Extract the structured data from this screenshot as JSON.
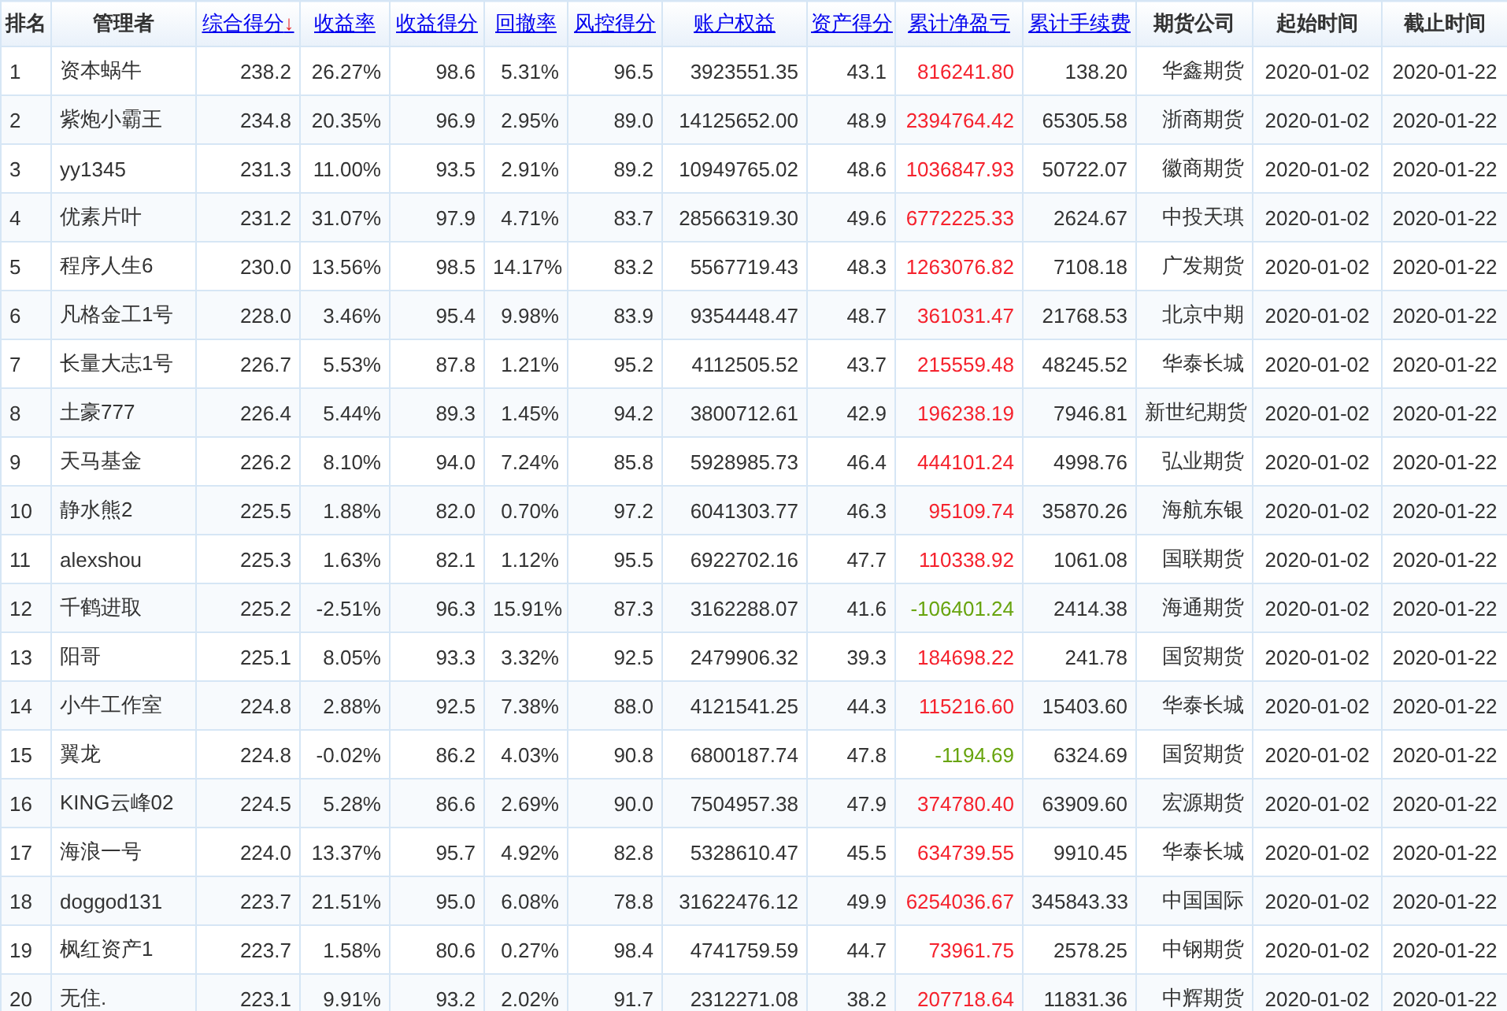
{
  "table": {
    "columns": [
      {
        "label": "排名",
        "link": false
      },
      {
        "label": "管理者",
        "link": false
      },
      {
        "label": "综合得分",
        "link": true,
        "sort_arrow": "↓"
      },
      {
        "label": "收益率",
        "link": true
      },
      {
        "label": "收益得分",
        "link": true
      },
      {
        "label": "回撤率",
        "link": true
      },
      {
        "label": "风控得分",
        "link": true
      },
      {
        "label": "账户权益",
        "link": true
      },
      {
        "label": "资产得分",
        "link": true
      },
      {
        "label": "累计净盈亏",
        "link": true
      },
      {
        "label": "累计手续费",
        "link": true
      },
      {
        "label": "期货公司",
        "link": false
      },
      {
        "label": "起始时间",
        "link": false
      },
      {
        "label": "截止时间",
        "link": false
      }
    ],
    "rows": [
      {
        "rank": "1",
        "manager": "资本蜗牛",
        "score": "238.2",
        "return_rate": "26.27%",
        "return_score": "98.6",
        "drawdown": "5.31%",
        "risk_score": "96.5",
        "equity": "3923551.35",
        "asset_score": "43.1",
        "net_pnl": "816241.80",
        "pnl_positive": true,
        "fees": "138.20",
        "broker": "华鑫期货",
        "start": "2020-01-02",
        "end": "2020-01-22"
      },
      {
        "rank": "2",
        "manager": "紫炮小霸王",
        "score": "234.8",
        "return_rate": "20.35%",
        "return_score": "96.9",
        "drawdown": "2.95%",
        "risk_score": "89.0",
        "equity": "14125652.00",
        "asset_score": "48.9",
        "net_pnl": "2394764.42",
        "pnl_positive": true,
        "fees": "65305.58",
        "broker": "浙商期货",
        "start": "2020-01-02",
        "end": "2020-01-22"
      },
      {
        "rank": "3",
        "manager": "yy1345",
        "score": "231.3",
        "return_rate": "11.00%",
        "return_score": "93.5",
        "drawdown": "2.91%",
        "risk_score": "89.2",
        "equity": "10949765.02",
        "asset_score": "48.6",
        "net_pnl": "1036847.93",
        "pnl_positive": true,
        "fees": "50722.07",
        "broker": "徽商期货",
        "start": "2020-01-02",
        "end": "2020-01-22"
      },
      {
        "rank": "4",
        "manager": "优素片叶",
        "score": "231.2",
        "return_rate": "31.07%",
        "return_score": "97.9",
        "drawdown": "4.71%",
        "risk_score": "83.7",
        "equity": "28566319.30",
        "asset_score": "49.6",
        "net_pnl": "6772225.33",
        "pnl_positive": true,
        "fees": "2624.67",
        "broker": "中投天琪",
        "start": "2020-01-02",
        "end": "2020-01-22"
      },
      {
        "rank": "5",
        "manager": "程序人生6",
        "score": "230.0",
        "return_rate": "13.56%",
        "return_score": "98.5",
        "drawdown": "14.17%",
        "risk_score": "83.2",
        "equity": "5567719.43",
        "asset_score": "48.3",
        "net_pnl": "1263076.82",
        "pnl_positive": true,
        "fees": "7108.18",
        "broker": "广发期货",
        "start": "2020-01-02",
        "end": "2020-01-22"
      },
      {
        "rank": "6",
        "manager": "凡格金工1号",
        "score": "228.0",
        "return_rate": "3.46%",
        "return_score": "95.4",
        "drawdown": "9.98%",
        "risk_score": "83.9",
        "equity": "9354448.47",
        "asset_score": "48.7",
        "net_pnl": "361031.47",
        "pnl_positive": true,
        "fees": "21768.53",
        "broker": "北京中期",
        "start": "2020-01-02",
        "end": "2020-01-22"
      },
      {
        "rank": "7",
        "manager": "长量大志1号",
        "score": "226.7",
        "return_rate": "5.53%",
        "return_score": "87.8",
        "drawdown": "1.21%",
        "risk_score": "95.2",
        "equity": "4112505.52",
        "asset_score": "43.7",
        "net_pnl": "215559.48",
        "pnl_positive": true,
        "fees": "48245.52",
        "broker": "华泰长城",
        "start": "2020-01-02",
        "end": "2020-01-22"
      },
      {
        "rank": "8",
        "manager": "土豪777",
        "score": "226.4",
        "return_rate": "5.44%",
        "return_score": "89.3",
        "drawdown": "1.45%",
        "risk_score": "94.2",
        "equity": "3800712.61",
        "asset_score": "42.9",
        "net_pnl": "196238.19",
        "pnl_positive": true,
        "fees": "7946.81",
        "broker": "新世纪期货",
        "start": "2020-01-02",
        "end": "2020-01-22"
      },
      {
        "rank": "9",
        "manager": "天马基金",
        "score": "226.2",
        "return_rate": "8.10%",
        "return_score": "94.0",
        "drawdown": "7.24%",
        "risk_score": "85.8",
        "equity": "5928985.73",
        "asset_score": "46.4",
        "net_pnl": "444101.24",
        "pnl_positive": true,
        "fees": "4998.76",
        "broker": "弘业期货",
        "start": "2020-01-02",
        "end": "2020-01-22"
      },
      {
        "rank": "10",
        "manager": "静水熊2",
        "score": "225.5",
        "return_rate": "1.88%",
        "return_score": "82.0",
        "drawdown": "0.70%",
        "risk_score": "97.2",
        "equity": "6041303.77",
        "asset_score": "46.3",
        "net_pnl": "95109.74",
        "pnl_positive": true,
        "fees": "35870.26",
        "broker": "海航东银",
        "start": "2020-01-02",
        "end": "2020-01-22"
      },
      {
        "rank": "11",
        "manager": "alexshou",
        "score": "225.3",
        "return_rate": "1.63%",
        "return_score": "82.1",
        "drawdown": "1.12%",
        "risk_score": "95.5",
        "equity": "6922702.16",
        "asset_score": "47.7",
        "net_pnl": "110338.92",
        "pnl_positive": true,
        "fees": "1061.08",
        "broker": "国联期货",
        "start": "2020-01-02",
        "end": "2020-01-22"
      },
      {
        "rank": "12",
        "manager": "千鹤进取",
        "score": "225.2",
        "return_rate": "-2.51%",
        "return_score": "96.3",
        "drawdown": "15.91%",
        "risk_score": "87.3",
        "equity": "3162288.07",
        "asset_score": "41.6",
        "net_pnl": "-106401.24",
        "pnl_positive": false,
        "fees": "2414.38",
        "broker": "海通期货",
        "start": "2020-01-02",
        "end": "2020-01-22"
      },
      {
        "rank": "13",
        "manager": "阳哥",
        "score": "225.1",
        "return_rate": "8.05%",
        "return_score": "93.3",
        "drawdown": "3.32%",
        "risk_score": "92.5",
        "equity": "2479906.32",
        "asset_score": "39.3",
        "net_pnl": "184698.22",
        "pnl_positive": true,
        "fees": "241.78",
        "broker": "国贸期货",
        "start": "2020-01-02",
        "end": "2020-01-22"
      },
      {
        "rank": "14",
        "manager": "小牛工作室",
        "score": "224.8",
        "return_rate": "2.88%",
        "return_score": "92.5",
        "drawdown": "7.38%",
        "risk_score": "88.0",
        "equity": "4121541.25",
        "asset_score": "44.3",
        "net_pnl": "115216.60",
        "pnl_positive": true,
        "fees": "15403.60",
        "broker": "华泰长城",
        "start": "2020-01-02",
        "end": "2020-01-22"
      },
      {
        "rank": "15",
        "manager": "翼龙",
        "score": "224.8",
        "return_rate": "-0.02%",
        "return_score": "86.2",
        "drawdown": "4.03%",
        "risk_score": "90.8",
        "equity": "6800187.74",
        "asset_score": "47.8",
        "net_pnl": "-1194.69",
        "pnl_positive": false,
        "fees": "6324.69",
        "broker": "国贸期货",
        "start": "2020-01-02",
        "end": "2020-01-22"
      },
      {
        "rank": "16",
        "manager": "KING云峰02",
        "score": "224.5",
        "return_rate": "5.28%",
        "return_score": "86.6",
        "drawdown": "2.69%",
        "risk_score": "90.0",
        "equity": "7504957.38",
        "asset_score": "47.9",
        "net_pnl": "374780.40",
        "pnl_positive": true,
        "fees": "63909.60",
        "broker": "宏源期货",
        "start": "2020-01-02",
        "end": "2020-01-22"
      },
      {
        "rank": "17",
        "manager": "海浪一号",
        "score": "224.0",
        "return_rate": "13.37%",
        "return_score": "95.7",
        "drawdown": "4.92%",
        "risk_score": "82.8",
        "equity": "5328610.47",
        "asset_score": "45.5",
        "net_pnl": "634739.55",
        "pnl_positive": true,
        "fees": "9910.45",
        "broker": "华泰长城",
        "start": "2020-01-02",
        "end": "2020-01-22"
      },
      {
        "rank": "18",
        "manager": "doggod131",
        "score": "223.7",
        "return_rate": "21.51%",
        "return_score": "95.0",
        "drawdown": "6.08%",
        "risk_score": "78.8",
        "equity": "31622476.12",
        "asset_score": "49.9",
        "net_pnl": "6254036.67",
        "pnl_positive": true,
        "fees": "345843.33",
        "broker": "中国国际",
        "start": "2020-01-02",
        "end": "2020-01-22"
      },
      {
        "rank": "19",
        "manager": "枫红资产1",
        "score": "223.7",
        "return_rate": "1.58%",
        "return_score": "80.6",
        "drawdown": "0.27%",
        "risk_score": "98.4",
        "equity": "4741759.59",
        "asset_score": "44.7",
        "net_pnl": "73961.75",
        "pnl_positive": true,
        "fees": "2578.25",
        "broker": "中钢期货",
        "start": "2020-01-02",
        "end": "2020-01-22"
      },
      {
        "rank": "20",
        "manager": "无住.",
        "score": "223.1",
        "return_rate": "9.91%",
        "return_score": "93.2",
        "drawdown": "2.02%",
        "risk_score": "91.7",
        "equity": "2312271.08",
        "asset_score": "38.2",
        "net_pnl": "207718.64",
        "pnl_positive": true,
        "fees": "11831.36",
        "broker": "中辉期货",
        "start": "2020-01-02",
        "end": "2020-01-22"
      }
    ]
  }
}
